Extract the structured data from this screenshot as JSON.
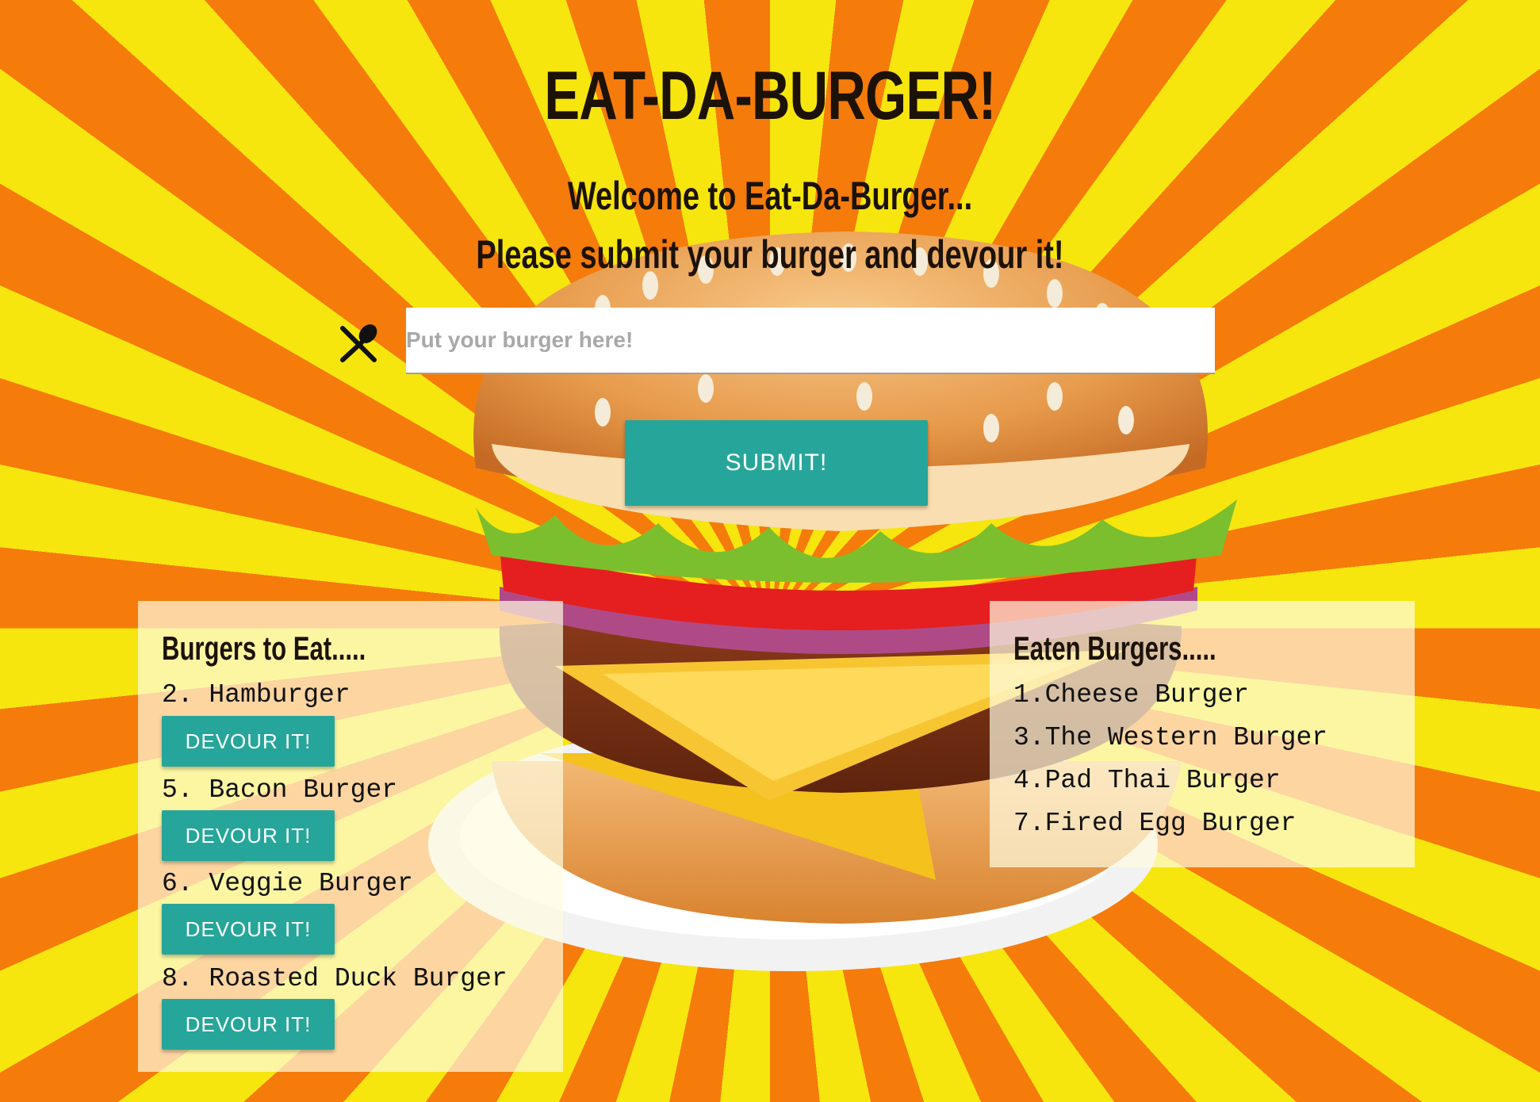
{
  "header": {
    "title": "EAT-DA-BURGER!",
    "welcome": "Welcome to Eat-Da-Burger...",
    "prompt": "Please submit your burger and devour it!"
  },
  "form": {
    "icon": "fork-spoon-icon",
    "input_value": "",
    "input_placeholder": "Put your burger here!",
    "submit_label": "SUBMIT!"
  },
  "to_eat": {
    "title": "Burgers to Eat.....",
    "items": [
      {
        "label": "2. Hamburger",
        "button": "DEVOUR IT!"
      },
      {
        "label": "5. Bacon Burger",
        "button": "DEVOUR IT!"
      },
      {
        "label": "6. Veggie Burger",
        "button": "DEVOUR IT!"
      },
      {
        "label": "8. Roasted Duck Burger",
        "button": "DEVOUR IT!"
      }
    ]
  },
  "eaten": {
    "title": "Eaten Burgers.....",
    "items": [
      "1.Cheese Burger",
      "3.The Western Burger",
      "4.Pad Thai Burger",
      "7.Fired Egg Burger"
    ]
  },
  "colors": {
    "accent": "#26a69a",
    "sunburst_yellow": "#f6e60e",
    "sunburst_orange": "#f57b0b",
    "heading_text": "#1c1208"
  }
}
